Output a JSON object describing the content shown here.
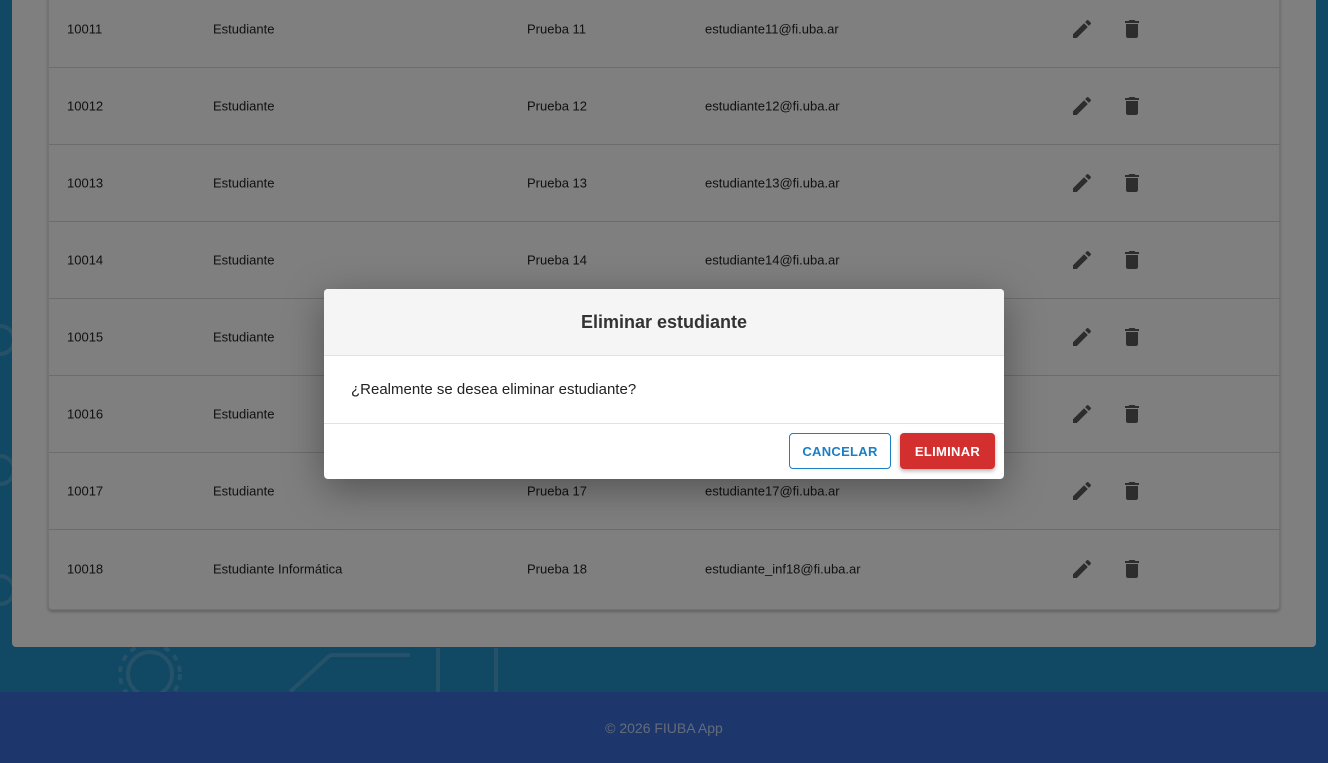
{
  "table": {
    "rows": [
      {
        "id": "10011",
        "name": "Estudiante",
        "last": "Prueba 11",
        "email": "estudiante11@fi.uba.ar"
      },
      {
        "id": "10012",
        "name": "Estudiante",
        "last": "Prueba 12",
        "email": "estudiante12@fi.uba.ar"
      },
      {
        "id": "10013",
        "name": "Estudiante",
        "last": "Prueba 13",
        "email": "estudiante13@fi.uba.ar"
      },
      {
        "id": "10014",
        "name": "Estudiante",
        "last": "Prueba 14",
        "email": "estudiante14@fi.uba.ar"
      },
      {
        "id": "10015",
        "name": "Estudiante",
        "last": "",
        "email": ""
      },
      {
        "id": "10016",
        "name": "Estudiante",
        "last": "",
        "email": ""
      },
      {
        "id": "10017",
        "name": "Estudiante",
        "last": "Prueba 17",
        "email": "estudiante17@fi.uba.ar"
      },
      {
        "id": "10018",
        "name": "Estudiante Informática",
        "last": "Prueba 18",
        "email": "estudiante_inf18@fi.uba.ar"
      }
    ],
    "action_icons": [
      "pencil-icon",
      "trash-icon"
    ]
  },
  "modal": {
    "title": "Eliminar estudiante",
    "message": "¿Realmente se desea eliminar estudiante?",
    "cancel_label": "CANCELAR",
    "delete_label": "ELIMINAR"
  },
  "footer": {
    "text": "© 2026 FIUBA App"
  },
  "colors": {
    "page_background": "#2390c9",
    "footer_background": "#3a6fd8",
    "primary": "#1a7fc4",
    "danger": "#d32f2f"
  }
}
